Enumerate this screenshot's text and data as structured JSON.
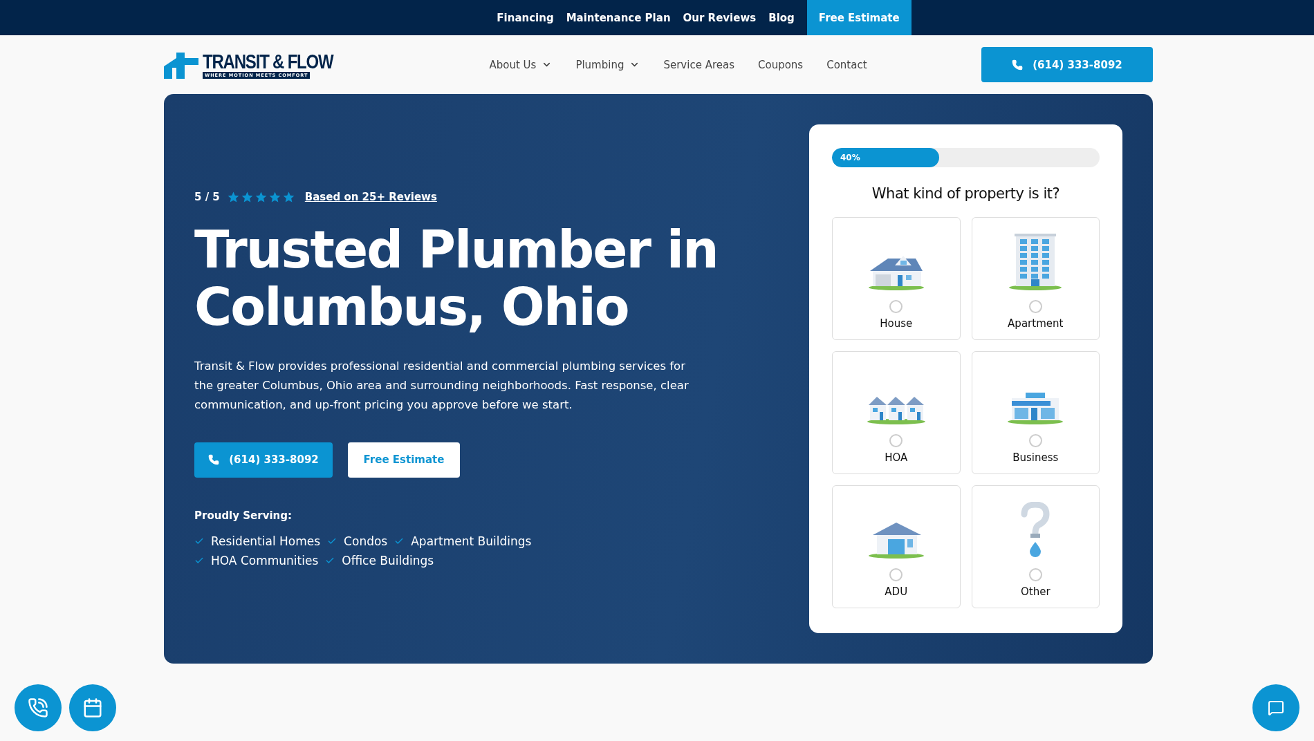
{
  "top_bar": {
    "links": [
      "Financing",
      "Maintenance Plan",
      "Our Reviews",
      "Blog"
    ],
    "cta": "Free Estimate"
  },
  "header": {
    "logo": {
      "name": "TRANSIT & FLOW",
      "tagline": "WHERE MOTION MEETS COMFORT"
    },
    "nav": [
      {
        "label": "About Us",
        "dropdown": true
      },
      {
        "label": "Plumbing",
        "dropdown": true
      },
      {
        "label": "Service Areas",
        "dropdown": false
      },
      {
        "label": "Coupons",
        "dropdown": false
      },
      {
        "label": "Contact",
        "dropdown": false
      }
    ],
    "phone_button": "(614) 333-8092"
  },
  "hero": {
    "rating": "5 / 5",
    "stars": 5,
    "reviews_link": "Based on 25+ Reviews",
    "title": "Trusted Plumber in Columbus, Ohio",
    "description": "Transit & Flow provides professional residential and commercial plumbing services for the greater Columbus, Ohio area and surrounding neighborhoods. Fast response, clear communication, and up-front pricing you approve before we start.",
    "phone_button": "(614) 333-8092",
    "estimate_button": "Free Estimate",
    "serving_label": "Proudly Serving:",
    "serving": [
      [
        "Residential Homes",
        "Condos",
        "Apartment Buildings"
      ],
      [
        "HOA Communities",
        "Office Buildings"
      ]
    ]
  },
  "quiz": {
    "progress": {
      "level": 0.4,
      "label": "40%"
    },
    "question": "What kind of property is it?",
    "options": [
      {
        "kind": "house",
        "label": "House",
        "selected": false
      },
      {
        "kind": "apartment",
        "label": "Apartment",
        "selected": false
      },
      {
        "kind": "hoa",
        "label": "HOA",
        "selected": false
      },
      {
        "kind": "business",
        "label": "Business",
        "selected": false
      },
      {
        "kind": "adu",
        "label": "ADU",
        "selected": false
      },
      {
        "kind": "other",
        "label": "Other",
        "selected": false
      }
    ]
  },
  "floating_buttons": [
    {
      "kind": "call"
    },
    {
      "kind": "calendar"
    },
    {
      "kind": "chat"
    }
  ]
}
